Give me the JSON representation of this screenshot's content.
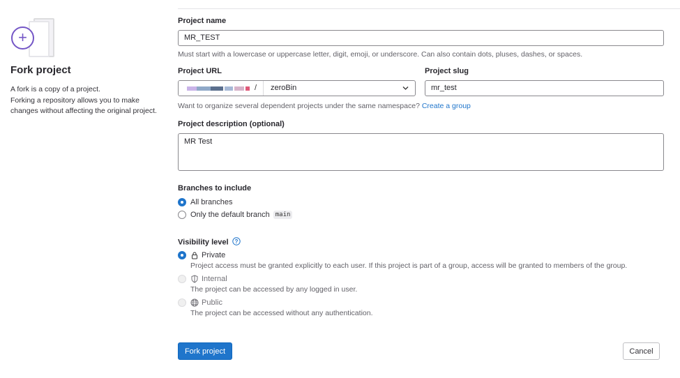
{
  "sidebar": {
    "title": "Fork project",
    "description_1": "A fork is a copy of a project.",
    "description_2": "Forking a repository allows you to make changes without affecting the original project."
  },
  "form": {
    "project_name": {
      "label": "Project name",
      "value": "MR_TEST",
      "help": "Must start with a lowercase or uppercase letter, digit, emoji, or underscore. Can also contain dots, pluses, dashes, or spaces."
    },
    "project_url": {
      "label": "Project URL",
      "separator": "/",
      "namespace": "zeroBin"
    },
    "project_slug": {
      "label": "Project slug",
      "value": "mr_test"
    },
    "namespace_help": {
      "text": "Want to organize several dependent projects under the same namespace?",
      "link": "Create a group"
    },
    "description": {
      "label": "Project description (optional)",
      "value": "MR Test"
    },
    "branches": {
      "label": "Branches to include",
      "options": [
        {
          "label": "All branches",
          "checked": true
        },
        {
          "label": "Only the default branch",
          "badge": "main",
          "checked": false
        }
      ]
    },
    "visibility": {
      "label": "Visibility level",
      "options": [
        {
          "label": "Private",
          "icon": "lock-icon",
          "description": "Project access must be granted explicitly to each user. If this project is part of a group, access will be granted to members of the group.",
          "checked": true
        },
        {
          "label": "Internal",
          "icon": "shield-icon",
          "description": "The project can be accessed by any logged in user.",
          "checked": false,
          "disabled": true
        },
        {
          "label": "Public",
          "icon": "globe-icon",
          "description": "The project can be accessed without any authentication.",
          "checked": false,
          "disabled": true
        }
      ]
    },
    "fork_button": "Fork project",
    "cancel_button": "Cancel"
  },
  "colors": {
    "primary": "#1f75cb",
    "illustration": "#7456c6"
  }
}
